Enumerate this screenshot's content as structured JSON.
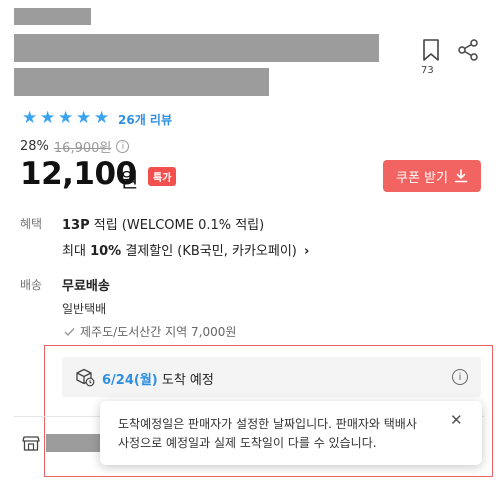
{
  "product": {
    "bookmark_count": "73",
    "rating_stars": 5,
    "review_count": "26개 리뷰",
    "discount_rate": "28%",
    "original_price": "16,900원",
    "price": "12,100",
    "currency": "원",
    "badge": "특가",
    "coupon_button": "쿠폰 받기"
  },
  "benefit": {
    "label": "혜택",
    "points_strong": "13P",
    "points_rest": " 적립 (WELCOME 0.1% 적립)",
    "max_prefix": "최대 ",
    "max_strong": "10%",
    "max_rest": " 결제할인 (KB국민, 카카오페이)"
  },
  "shipping": {
    "label": "배송",
    "free": "무료배송",
    "type": "일반택배",
    "extra": "제주도/도서산간 지역 7,000원"
  },
  "arrival": {
    "date": "6/24(월)",
    "suffix": " 도착 예정"
  },
  "tooltip": {
    "line1": "도착예정일은 판매자가 설정한 날짜입니다. 판매자와 택배사",
    "line2": "사정으로 예정일과 실제 도착일이 다를 수 있습니다."
  },
  "colors": {
    "accent_blue": "#2f8fe0",
    "coupon_red": "#f26462",
    "badge_red": "#f2504e",
    "highlight_border": "#e86366"
  }
}
